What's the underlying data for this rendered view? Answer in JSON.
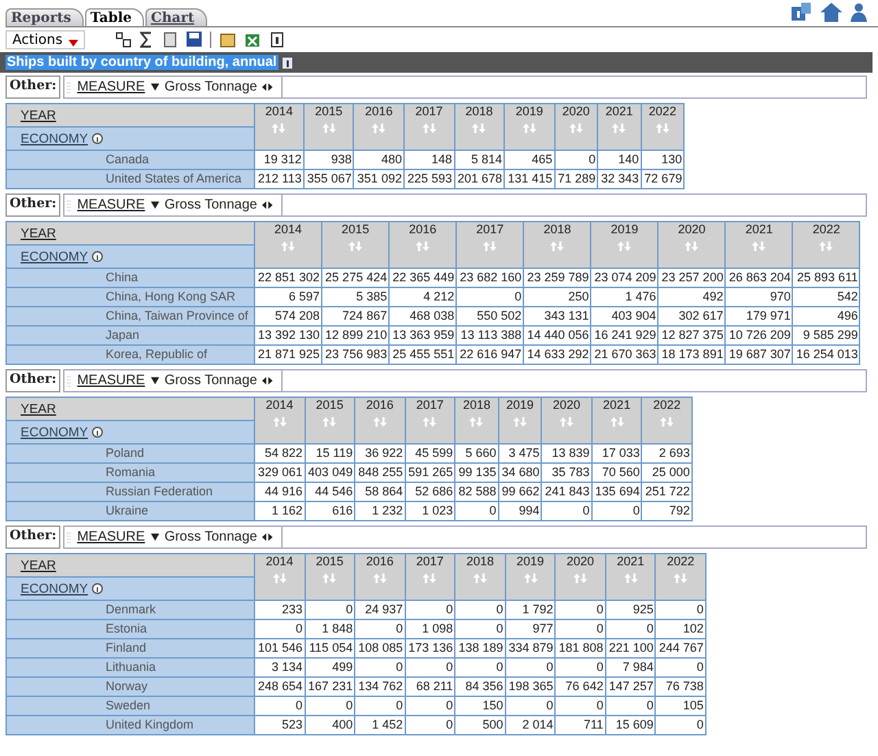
{
  "tabs": [
    {
      "label": "Reports",
      "selected": false
    },
    {
      "label": "Table",
      "selected": true
    },
    {
      "label": "Chart",
      "selected": false
    }
  ],
  "actions_menu": {
    "label": "Actions"
  },
  "title": "Ships built by country of building, annual",
  "tables": [
    {
      "other_label": "Other:",
      "dimension": "MEASURE",
      "value": "Gross Tonnage",
      "year_label": "YEAR",
      "economy_label": "ECONOMY",
      "years": [
        "2014",
        "2015",
        "2016",
        "2017",
        "2018",
        "2019",
        "2020",
        "2021",
        "2022"
      ],
      "rows": [
        {
          "name": "Canada",
          "values": [
            "19 312",
            "938",
            "480",
            "148",
            "5 814",
            "465",
            "0",
            "140",
            "130"
          ]
        },
        {
          "name": "United States of America",
          "values": [
            "212 113",
            "355 067",
            "351 092",
            "225 593",
            "201 678",
            "131 415",
            "71 289",
            "32 343",
            "72 679"
          ]
        }
      ]
    },
    {
      "other_label": "Other:",
      "dimension": "MEASURE",
      "value": "Gross Tonnage",
      "year_label": "YEAR",
      "economy_label": "ECONOMY",
      "years": [
        "2014",
        "2015",
        "2016",
        "2017",
        "2018",
        "2019",
        "2020",
        "2021",
        "2022"
      ],
      "rows": [
        {
          "name": "China",
          "values": [
            "22 851 302",
            "25 275 424",
            "22 365 449",
            "23 682 160",
            "23 259 789",
            "23 074 209",
            "23 257 200",
            "26 863 204",
            "25 893 611"
          ]
        },
        {
          "name": "China, Hong Kong SAR",
          "values": [
            "6 597",
            "5 385",
            "4 212",
            "0",
            "250",
            "1 476",
            "492",
            "970",
            "542"
          ]
        },
        {
          "name": "China, Taiwan Province of",
          "values": [
            "574 208",
            "724 867",
            "468 038",
            "550 502",
            "343 131",
            "403 904",
            "302 617",
            "179 971",
            "496"
          ]
        },
        {
          "name": "Japan",
          "values": [
            "13 392 130",
            "12 899 210",
            "13 363 959",
            "13 113 388",
            "14 440 056",
            "16 241 929",
            "12 827 375",
            "10 726 209",
            "9 585 299"
          ]
        },
        {
          "name": "Korea, Republic of",
          "values": [
            "21 871 925",
            "23 756 983",
            "25 455 551",
            "22 616 947",
            "14 633 292",
            "21 670 363",
            "18 173 891",
            "19 687 307",
            "16 254 013"
          ]
        }
      ]
    },
    {
      "other_label": "Other:",
      "dimension": "MEASURE",
      "value": "Gross Tonnage",
      "year_label": "YEAR",
      "economy_label": "ECONOMY",
      "years": [
        "2014",
        "2015",
        "2016",
        "2017",
        "2018",
        "2019",
        "2020",
        "2021",
        "2022"
      ],
      "rows": [
        {
          "name": "Poland",
          "values": [
            "54 822",
            "15 119",
            "36 922",
            "45 599",
            "5 660",
            "3 475",
            "13 839",
            "17 033",
            "2 693"
          ]
        },
        {
          "name": "Romania",
          "values": [
            "329 061",
            "403 049",
            "848 255",
            "591 265",
            "99 135",
            "34 680",
            "35 783",
            "70 560",
            "25 000"
          ]
        },
        {
          "name": "Russian Federation",
          "values": [
            "44 916",
            "44 546",
            "58 864",
            "52 686",
            "82 588",
            "99 662",
            "241 843",
            "135 694",
            "251 722"
          ]
        },
        {
          "name": "Ukraine",
          "values": [
            "1 162",
            "616",
            "1 232",
            "1 023",
            "0",
            "994",
            "0",
            "0",
            "792"
          ]
        }
      ]
    },
    {
      "other_label": "Other:",
      "dimension": "MEASURE",
      "value": "Gross Tonnage",
      "year_label": "YEAR",
      "economy_label": "ECONOMY",
      "years": [
        "2014",
        "2015",
        "2016",
        "2017",
        "2018",
        "2019",
        "2020",
        "2021",
        "2022"
      ],
      "rows": [
        {
          "name": "Denmark",
          "values": [
            "233",
            "0",
            "24 937",
            "0",
            "0",
            "1 792",
            "0",
            "925",
            "0"
          ]
        },
        {
          "name": "Estonia",
          "values": [
            "0",
            "1 848",
            "0",
            "1 098",
            "0",
            "977",
            "0",
            "0",
            "102"
          ]
        },
        {
          "name": "Finland",
          "values": [
            "101 546",
            "115 054",
            "108 085",
            "173 136",
            "138 189",
            "334 879",
            "181 808",
            "221 100",
            "244 767"
          ]
        },
        {
          "name": "Lithuania",
          "values": [
            "3 134",
            "499",
            "0",
            "0",
            "0",
            "0",
            "0",
            "7 984",
            "0"
          ]
        },
        {
          "name": "Norway",
          "values": [
            "248 654",
            "167 231",
            "134 762",
            "68 211",
            "84 356",
            "198 365",
            "76 642",
            "147 257",
            "76 738"
          ]
        },
        {
          "name": "Sweden",
          "values": [
            "0",
            "0",
            "0",
            "0",
            "150",
            "0",
            "0",
            "0",
            "105"
          ]
        },
        {
          "name": "United Kingdom",
          "values": [
            "523",
            "400",
            "1 452",
            "0",
            "500",
            "2 014",
            "711",
            "15 609",
            "0"
          ]
        }
      ]
    }
  ]
}
